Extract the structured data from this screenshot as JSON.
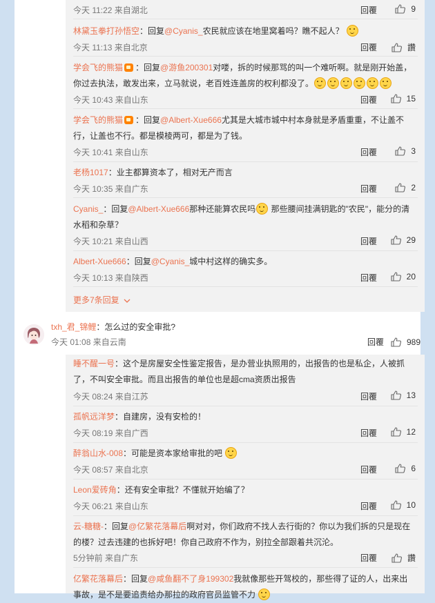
{
  "top_group": {
    "replies": [
      {
        "meta": "今天 11:22 来自湖北",
        "reply": "回覆",
        "likes": "9"
      },
      {
        "user": "林黛玉拳打孙悟空",
        "prefix": "：回复",
        "mention": "@Cyanis_",
        "body": "农民就应该在地里窝着吗？瞧不起人？",
        "meta": "今天 11:13 来自北京",
        "reply": "回覆",
        "likes": "讚"
      },
      {
        "user": "学会飞的熊猫",
        "prefix": "：回复",
        "mention": "@游鱼200301",
        "body1": "对喽，拆的时候那骂的叫一个难听啊。就是刚开始盖，",
        "body2": "你过去执法，敢发出来，立马就说，老百姓连盖房的权利都没了。",
        "meta": "今天 10:43 来自山东",
        "reply": "回覆",
        "likes": "15"
      },
      {
        "user": "学会飞的熊猫",
        "prefix": "：回复",
        "mention": "@Albert-Xue666",
        "body1": "尤其是大城市城中村本身就是矛盾重重，不让盖不",
        "body2": "行，让盖也不行。都是模棱两可，都是为了钱。",
        "meta": "今天 10:41 来自山东",
        "reply": "回覆",
        "likes": "3"
      },
      {
        "user": "老杨1017",
        "body": "：业主都算资本了，相对无产而言",
        "meta": "今天 10:35 来自广东",
        "reply": "回覆",
        "likes": "2"
      },
      {
        "user": "Cyanis_",
        "prefix": "：回复",
        "mention": "@Albert-Xue666",
        "body1a": "那种还能算农民吗",
        "body1b": " 那些腰间挂满钥匙的\"农民\"，能分的清",
        "body2": "水稻和杂草？",
        "meta": "今天 10:21 来自山西",
        "reply": "回覆",
        "likes": "29"
      },
      {
        "user": "Albert-Xue666",
        "prefix": "：回复",
        "mention": "@Cyanis_",
        "body": "城中村这样的确实多。",
        "meta": "今天 10:13 来自陕西",
        "reply": "回覆",
        "likes": "20"
      }
    ],
    "more_label": "更多7条回复"
  },
  "comment": {
    "user": "txh_君_锦鲤",
    "body": "：怎么过的安全审批?",
    "meta": "今天 01:08 来自云南",
    "reply": "回覆",
    "likes": "989"
  },
  "bottom_group": {
    "replies": [
      {
        "user": "睡不醒一号",
        "body1": "：这个是房屋安全性鉴定报告，是办营业执照用的，出报告的也是私企，人被抓",
        "body2": "了，不叫安全审批。而且出报告的单位也是超cma资质出报告",
        "meta": "今天 08:24 来自江苏",
        "reply": "回覆",
        "likes": "13"
      },
      {
        "user": "孤帆远洋梦",
        "body": "：自建房，没有安检的！",
        "meta": "今天 08:19 来自广西",
        "reply": "回覆",
        "likes": "12"
      },
      {
        "user": "醉翁山水-008",
        "body": "：可能是资本家给审批的吧",
        "meta": "今天 08:57 来自北京",
        "reply": "回覆",
        "likes": "6"
      },
      {
        "user": "Leon爱砖角",
        "body": "：还有安全审批？不懂就开始编了？",
        "meta": "今天 06:21 来自山东",
        "reply": "回覆",
        "likes": "10"
      },
      {
        "user": "云-糖糖-",
        "prefix": "：回复",
        "mention": "@亿繁花落幕后",
        "body1": "啊对对，你们政府不找人去行街的？你以为我们拆的只是现在",
        "body2": "的楼？过去违建的也拆好吧！你自己政府不作为，别拉全部跟着共沉沦。",
        "meta": "5分钟前 来自广东",
        "reply": "回覆",
        "likes": "讚"
      },
      {
        "user": "亿繁花落幕后",
        "prefix": "：回复",
        "mention": "@咸鱼翻不了身199302",
        "body1": "我就像那些开驾校的，那些得了证的人，出来出",
        "body2": "事故，是不是要追责给办那拉的政府官员监管不力"
      }
    ]
  }
}
